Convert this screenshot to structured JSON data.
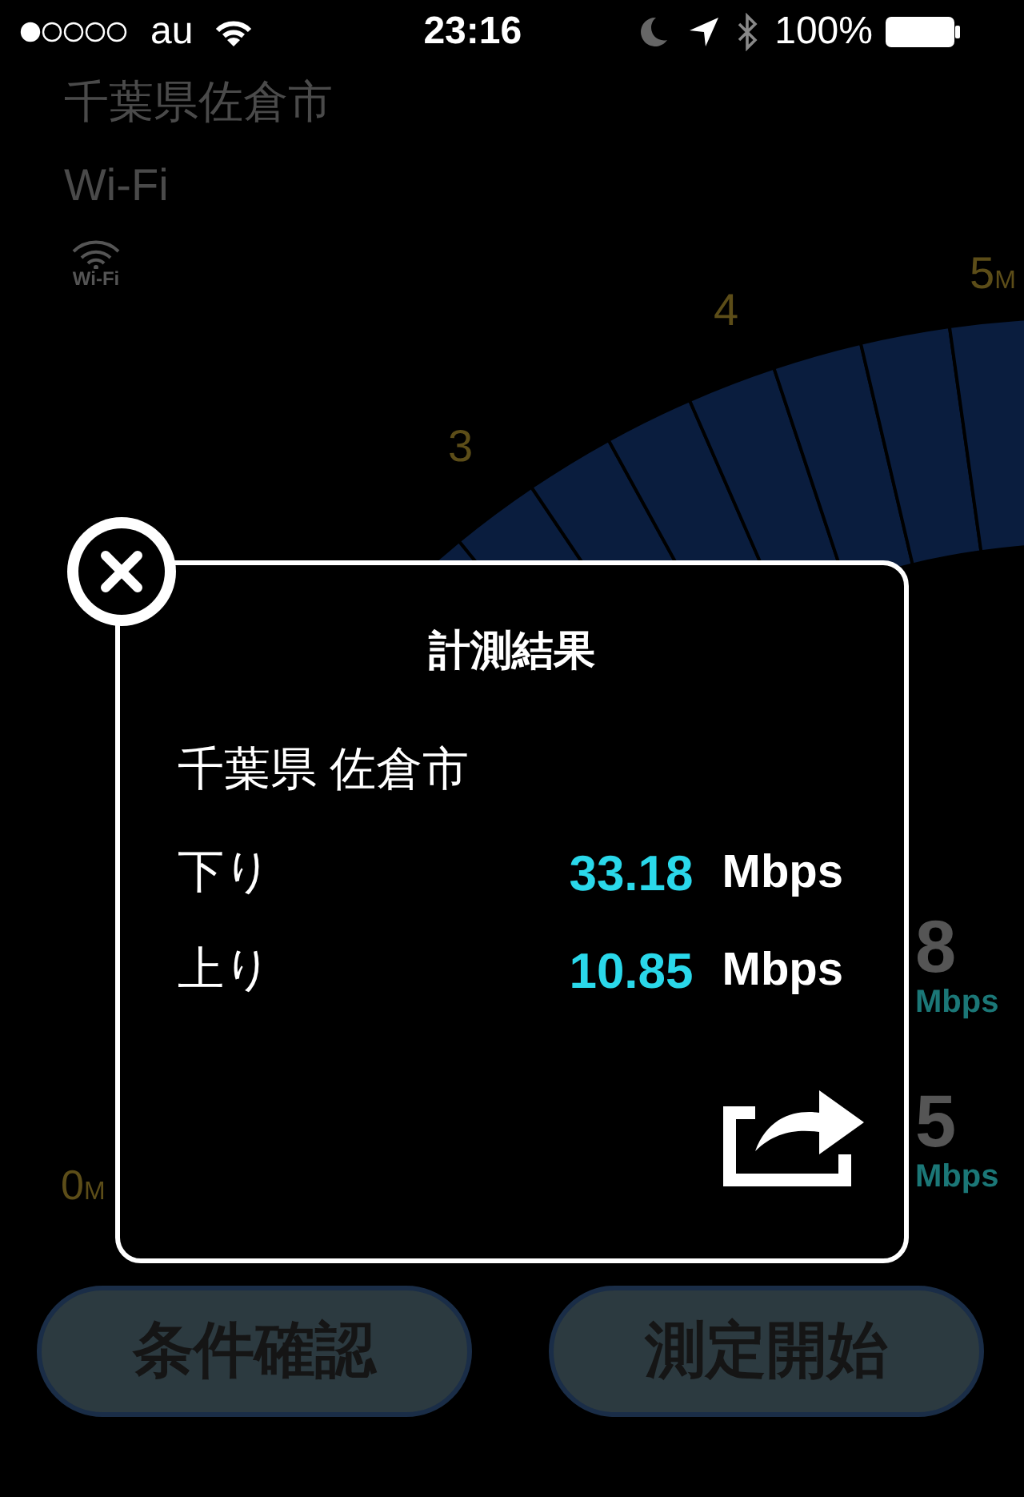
{
  "status_bar": {
    "carrier": "au",
    "time": "23:16",
    "battery": "100%"
  },
  "location": "千葉県佐倉市",
  "connection": "Wi-Fi",
  "connection_icon_label": "Wi-Fi",
  "gauge_labels": [
    "3",
    "4",
    "5M",
    "0M"
  ],
  "readings": [
    {
      "value": "8",
      "unit": "Mbps"
    },
    {
      "value": "5",
      "unit": "Mbps"
    }
  ],
  "dialog": {
    "title": "計測結果",
    "location": "千葉県 佐倉市",
    "rows": [
      {
        "label": "下り",
        "value": "33.18",
        "unit": "Mbps"
      },
      {
        "label": "上り",
        "value": "10.85",
        "unit": "Mbps"
      }
    ]
  },
  "buttons": [
    "条件確認",
    "測定開始"
  ]
}
